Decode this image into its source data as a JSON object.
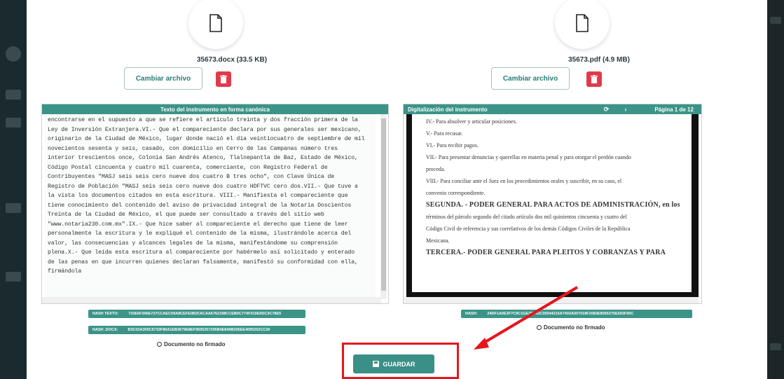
{
  "left_file": {
    "name": "35673.docx (33.5 KB)",
    "change_label": "Cambiar archivo"
  },
  "right_file": {
    "name": "35673.pdf (4.9 MB)",
    "change_label": "Cambiar archivo"
  },
  "canonical_panel": {
    "title": "Texto del instrumento en forma canónica",
    "lines": [
      "encontrarse en el supuesto a que se refiere el artículo treinta y dos fracción primera de la",
      "Ley de Inversión Extranjera.VI.- Que el compareciente declara por sus generales ser mexicano,",
      "originario de la Ciudad de México, lugar donde nació el día veintiocuatro de septiembre de mil",
      "novecientos sesenta y seis, casado, con domicilio en Cerro de las Campanas número tres",
      "interior trescientos once, Colonia San Andrés Atenco, Tlalnepantla de Baz, Estado de México,",
      "Código Postal cincuenta y cuatro mil cuarenta, comerciante, con Registro Federal de",
      "Contribuyentes \"MASJ seis seis cero nueve dos cuatro B tres ocho\", con Clave Única de",
      "Registro de Población \"MASJ seis seis cero nueve dos cuatro HDFTVC cero dos.VII.- Que tuve a",
      "la vista los documentos citados en esta escritura. VIII.- Manifiesta el compareciente que",
      "tiene conocimiento del contenido del aviso de privacidad integral de la Notaría Doscientos",
      "Treinta de la Ciudad de México, el que puede ser consultado a través del sitio web",
      "\"www.notaria230.com.mx\".IX.- Que hice saber al compareciente el derecho que tiene de leer",
      "personalmente la escritura y le expliqué el contenido de la misma, ilustrándole acerca del",
      "valor, las consecuencias y alcances legales de la misma, manifestándome su comprensión",
      "plena.X.- Que leída esta escritura al compareciente por habérmelo así solicitado y enterado",
      "de las penas en que incurren quienes declaran falsamente, manifestó su conformidad con ella,",
      "firmándola"
    ]
  },
  "scan_panel": {
    "title": "Digitalización del instrumento",
    "page_label": "Página 1 de 12",
    "lines": [
      {
        "text": "IV.- Para absolver y articular posiciones.",
        "style": "normal"
      },
      {
        "text": "V.- Para recusar.",
        "style": "normal"
      },
      {
        "text": "VI.- Para recibir pagos.",
        "style": "normal"
      },
      {
        "text": "VII.- Para presentar denuncias y querellas en materia penal y para otorgar el perdón cuando",
        "style": "normal"
      },
      {
        "text": "proceda.",
        "style": "normal"
      },
      {
        "text": "VIII.- Para conciliar ante el Juez en los procedimientos orales y suscribir, en su caso, el",
        "style": "normal"
      },
      {
        "text": "convenio correspondiente.",
        "style": "normal"
      },
      {
        "text": "SEGUNDA. - PODER GENERAL PARA ACTOS DE ADMINISTRACIÓN, en los",
        "style": "bold"
      },
      {
        "text": "términos del párrafo segundo del citado artículo dos mil quinientos cincuenta y cuatro del",
        "style": "normal"
      },
      {
        "text": "Código Civil de referencia y sus correlativos de los demás Códigos Civiles de la República",
        "style": "normal"
      },
      {
        "text": "Mexicana.",
        "style": "normal"
      },
      {
        "text": "TERCERA.- PODER GENERAL PARA PLEITOS Y COBRANZAS Y PARA",
        "style": "bold"
      }
    ]
  },
  "hashes": {
    "text_label": "HASH TEXTO:",
    "text_value": "733E6F296E727CCAEC09A8CEFE0B2C6CAA6762198CCEB0C774F019E0DC3C78E5",
    "docx_label": "HASH .DOCX:",
    "docx_value": "B3C03A305C5733F80A1EB3679E8EF9505257206B4E849B206EE4095252CC36",
    "pdf_label": "HASH:",
    "pdf_value": "24DF1A0E3F7C9C1GE2B043C35044215A7403A007018F2083E8056375E503F90C"
  },
  "unsigned_label": "Documento no firmado",
  "save_label": "GUARDAR",
  "colors": {
    "accent": "#3c9488",
    "danger": "#e03b4b",
    "highlight": "#e5161c"
  }
}
